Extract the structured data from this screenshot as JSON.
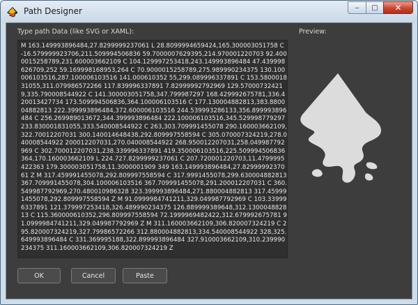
{
  "window": {
    "title": "Path Designer",
    "minimize_glyph": "‒",
    "maximize_glyph": "□",
    "close_glyph": "✕"
  },
  "labels": {
    "path_data": "Type path Data (like SVG or XAML):",
    "preview": "Preview:"
  },
  "path_text": "M 163.149993896484,27.8299999237061 L 28.8099994659424,165.300003051758 C -16.579999923706,211.509994506836 59.7000007629395,214.970001220703 92.4000015258789,231.600003662109 C 104.129997253418,243.149993896484 47.439998626709,252 59.169998168953,264 C 70.9000015258789,275.989990234375 130.100006103516,287.100006103516 141.000610352 55,299.089996337891 C 153.580001831055,311.079986572266 117.839996337891 7.82999992792969 129.570007324219,335.790008544922 C 141.300003051758,347.799987297 168.429992675781,336.420013427734 173.509994506836,364.100006103516 C 177.130004882813,383.880004882813 222.399993896484,372.600006103516 244.539993286133,356.899993896484 C 256.269989013672,344.399993896484 222.100006103516,345.529998779297 233.830001831055,333.540008544922 C 263,303.709991455078 290.160003662109,322.70012207031 300.140014648438,292.809997558594 C 305.070007324219,278.040008544922 200012207031,270.040008544922 268.950012207031,258.049987792969 C 302.700012207031,238.339996337891 419.350006103516,225.509994506836 364,170.160003662109 L 224.727.8299999237061 C 207.720001220703,11.4799995422363 179.300003051758,11.3000001909 349 163.149993896484,27.8299999237061 Z M 317.459991455078,292.809997558594 C 317.9991455078,299.630004882813 367.709991455078,304.100006103516 367.709991455078,291.200012207031 C 360.549987792969,270.480010986328 323.399993896484,271.880004882813 317.459991455078,292.809997558594 Z M 91.0999984741211,329.049987792969 C 103.339996337891 121.379997253418,326.489990234375 126.889999389648,312.130004882813 C 115.360000610352,296.809997558594 72.1999969482422,312.679992675781 91.0999984741211,329.049987792969 Z M 311.160003662109,306.820007324219 C 295.820007324219,327.79986572266 312.880004882813,334.540008544922 328,325.649993896484 C 331.369995188,322.899993896484 327.910003662109,310.239990234375 311.160003662109,306.820007324219 Z",
  "buttons": {
    "ok": "OK",
    "cancel": "Cancel",
    "paste": "Paste"
  },
  "preview": {
    "fill_color": "#dcdcdc",
    "shape": "inkscape-logo-shape"
  },
  "colors": {
    "dialog_bg": "#3d3d3d",
    "text_area_bg": "#2f2f2f",
    "text": "#e6e6e6"
  }
}
